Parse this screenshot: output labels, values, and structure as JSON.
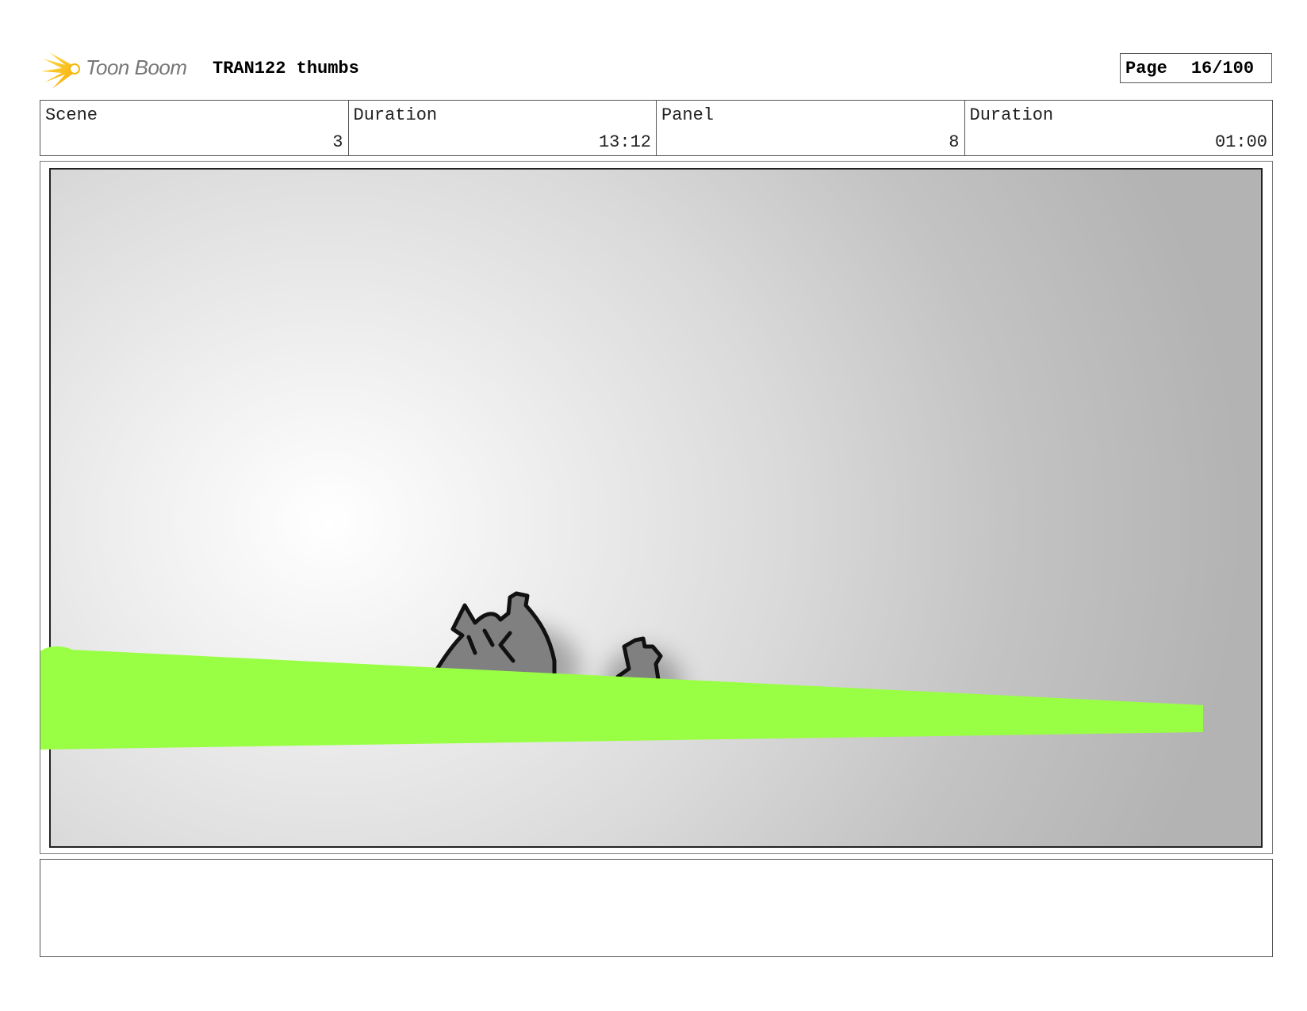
{
  "header": {
    "logo_text": "Toon Boom",
    "project_title": "TRAN122 thumbs",
    "page_label": "Page",
    "page_value": "16/100"
  },
  "info": {
    "scene_label": "Scene",
    "scene_value": "3",
    "scene_duration_label": "Duration",
    "scene_duration_value": "13:12",
    "panel_label": "Panel",
    "panel_value": "8",
    "panel_duration_label": "Duration",
    "panel_duration_value": "01:00"
  },
  "notes": {
    "text": ""
  },
  "colors": {
    "green_stroke": "#99ff44",
    "ink": "#111111",
    "figure_fill": "#808080"
  }
}
